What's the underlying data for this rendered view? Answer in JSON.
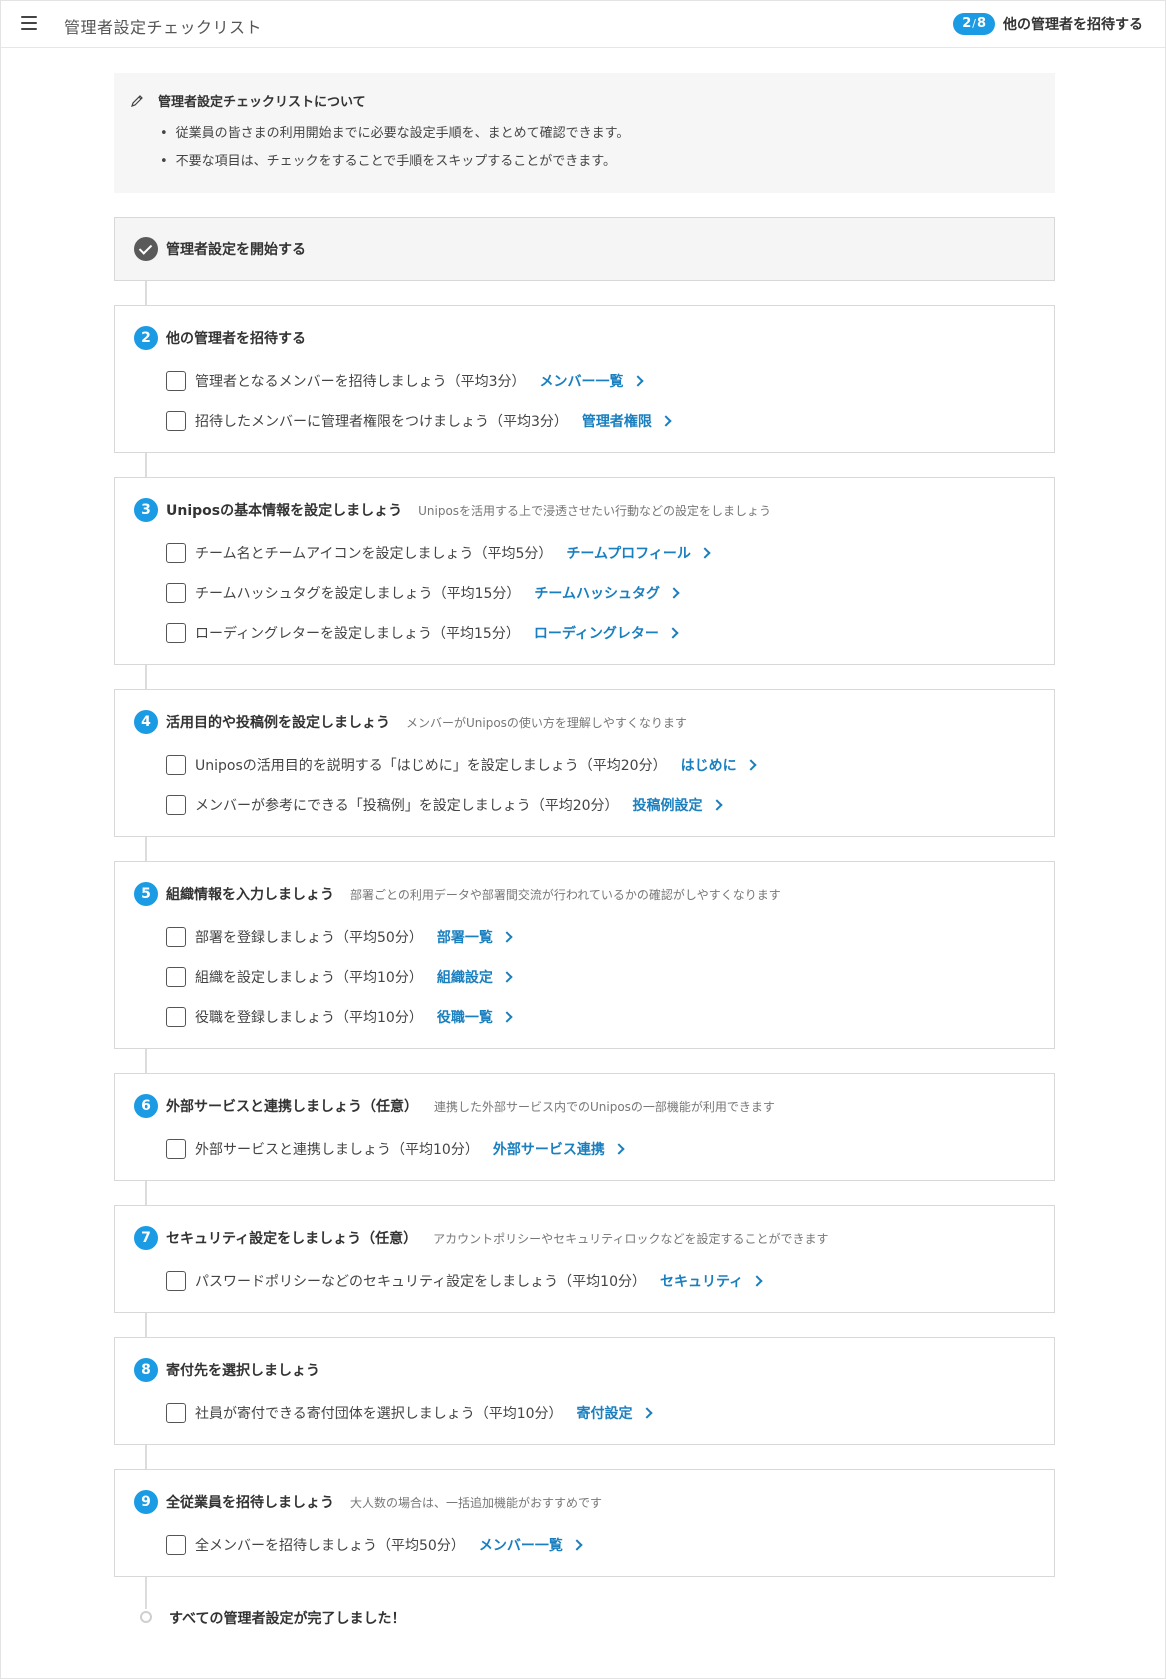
{
  "header": {
    "title": "管理者設定チェックリスト",
    "progress_current": "2",
    "progress_total": "8",
    "progress_label": "他の管理者を招待する"
  },
  "info": {
    "title": "管理者設定チェックリストについて",
    "items": [
      "従業員の皆さまの利用開始までに必要な設定手順を、まとめて確認できます。",
      "不要な項目は、チェックをすることで手順をスキップすることができます。"
    ]
  },
  "steps": [
    {
      "title": "管理者設定を開始する",
      "completed": true
    },
    {
      "number": "2",
      "title": "他の管理者を招待する",
      "description": "",
      "tasks": [
        {
          "text": "管理者となるメンバーを招待しましょう（平均3分）",
          "link": "メンバー一覧"
        },
        {
          "text": "招待したメンバーに管理者権限をつけましょう（平均3分）",
          "link": "管理者権限"
        }
      ]
    },
    {
      "number": "3",
      "title": "Uniposの基本情報を設定しましょう",
      "description": "Uniposを活用する上で浸透させたい行動などの設定をしましょう",
      "tasks": [
        {
          "text": "チーム名とチームアイコンを設定しましょう（平均5分）",
          "link": "チームプロフィール"
        },
        {
          "text": "チームハッシュタグを設定しましょう（平均15分）",
          "link": "チームハッシュタグ"
        },
        {
          "text": "ローディングレターを設定しましょう（平均15分）",
          "link": "ローディングレター"
        }
      ]
    },
    {
      "number": "4",
      "title": "活用目的や投稿例を設定しましょう",
      "description": "メンバーがUniposの使い方を理解しやすくなります",
      "tasks": [
        {
          "text": "Uniposの活用目的を説明する「はじめに」を設定しましょう（平均20分）",
          "link": "はじめに"
        },
        {
          "text": "メンバーが参考にできる「投稿例」を設定しましょう（平均20分）",
          "link": "投稿例設定"
        }
      ]
    },
    {
      "number": "5",
      "title": "組織情報を入力しましょう",
      "description": "部署ごとの利用データや部署間交流が行われているかの確認がしやすくなります",
      "tasks": [
        {
          "text": "部署を登録しましょう（平均50分）",
          "link": "部署一覧"
        },
        {
          "text": "組織を設定しましょう（平均10分）",
          "link": "組織設定"
        },
        {
          "text": "役職を登録しましょう（平均10分）",
          "link": "役職一覧"
        }
      ]
    },
    {
      "number": "6",
      "title": "外部サービスと連携しましょう（任意）",
      "description": "連携した外部サービス内でのUniposの一部機能が利用できます",
      "tasks": [
        {
          "text": "外部サービスと連携しましょう（平均10分）",
          "link": "外部サービス連携"
        }
      ]
    },
    {
      "number": "7",
      "title": "セキュリティ設定をしましょう（任意）",
      "description": "アカウントポリシーやセキュリティロックなどを設定することができます",
      "tasks": [
        {
          "text": "パスワードポリシーなどのセキュリティ設定をしましょう（平均10分）",
          "link": "セキュリティ"
        }
      ]
    },
    {
      "number": "8",
      "title": "寄付先を選択しましょう",
      "description": "",
      "tasks": [
        {
          "text": "社員が寄付できる寄付団体を選択しましょう（平均10分）",
          "link": "寄付設定"
        }
      ]
    },
    {
      "number": "9",
      "title": "全従業員を招待しましょう",
      "description": "大人数の場合は、一括追加機能がおすすめです",
      "tasks": [
        {
          "text": "全メンバーを招待しましょう（平均50分）",
          "link": "メンバー一覧"
        }
      ]
    }
  ],
  "completion": {
    "text": "すべての管理者設定が完了しました！"
  },
  "colors": {
    "accent": "#1a9be4",
    "link": "#1a7fbf",
    "done": "#5a5a5a"
  }
}
